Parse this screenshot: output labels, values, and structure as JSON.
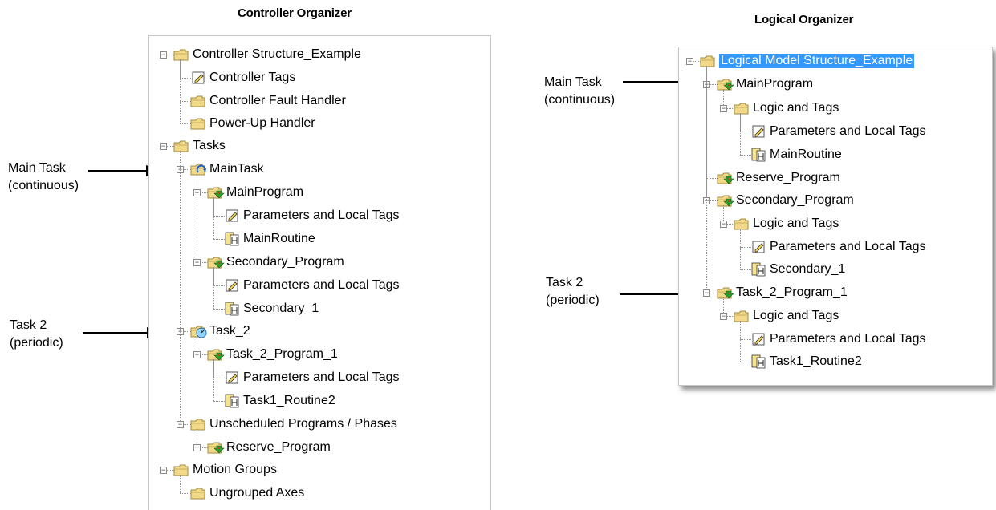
{
  "controller_organizer": {
    "heading": "Controller Organizer",
    "nodes": [
      {
        "label": "Controller Structure_Example",
        "icon": "folder-icon",
        "expander": "−"
      },
      {
        "label": "Controller Tags",
        "icon": "tags-icon"
      },
      {
        "label": "Controller Fault Handler",
        "icon": "folder-icon"
      },
      {
        "label": "Power-Up Handler",
        "icon": "folder-icon"
      },
      {
        "label": "Tasks",
        "icon": "folder-icon",
        "expander": "−"
      },
      {
        "label": "MainTask",
        "icon": "continuous-task-icon",
        "expander": "−"
      },
      {
        "label": "MainProgram",
        "icon": "program-icon",
        "expander": "−"
      },
      {
        "label": "Parameters and Local Tags",
        "icon": "tags-icon"
      },
      {
        "label": "MainRoutine",
        "icon": "routine-icon"
      },
      {
        "label": "Secondary_Program",
        "icon": "program-icon",
        "expander": "−"
      },
      {
        "label": "Parameters and Local Tags",
        "icon": "tags-icon"
      },
      {
        "label": "Secondary_1",
        "icon": "routine-icon"
      },
      {
        "label": "Task_2",
        "icon": "periodic-task-icon",
        "expander": "−"
      },
      {
        "label": "Task_2_Program_1",
        "icon": "program-icon",
        "expander": "−"
      },
      {
        "label": "Parameters and Local Tags",
        "icon": "tags-icon"
      },
      {
        "label": "Task1_Routine2",
        "icon": "routine-icon"
      },
      {
        "label": "Unscheduled Programs / Phases",
        "icon": "folder-icon",
        "expander": "−"
      },
      {
        "label": "Reserve_Program",
        "icon": "program-icon",
        "expander": "+"
      },
      {
        "label": "Motion Groups",
        "icon": "folder-icon",
        "expander": "−"
      },
      {
        "label": "Ungrouped Axes",
        "icon": "folder-icon"
      }
    ],
    "annotations": [
      {
        "line1": "Main Task",
        "line2": "(continuous)"
      },
      {
        "line1": "Task 2",
        "line2": "(periodic)"
      }
    ]
  },
  "logical_organizer": {
    "heading": "Logical Organizer",
    "nodes": [
      {
        "label": "Logical Model Structure_Example",
        "icon": "folder-icon",
        "expander": "−",
        "selected": true
      },
      {
        "label": "MainProgram",
        "icon": "program-icon",
        "expander": "−"
      },
      {
        "label": "Logic and Tags",
        "icon": "folder-icon",
        "expander": "−"
      },
      {
        "label": "Parameters and Local Tags",
        "icon": "tags-icon"
      },
      {
        "label": "MainRoutine",
        "icon": "routine-icon"
      },
      {
        "label": "Reserve_Program",
        "icon": "program-icon"
      },
      {
        "label": "Secondary_Program",
        "icon": "program-icon",
        "expander": "−"
      },
      {
        "label": "Logic and Tags",
        "icon": "folder-icon",
        "expander": "−"
      },
      {
        "label": "Parameters and Local Tags",
        "icon": "tags-icon"
      },
      {
        "label": "Secondary_1",
        "icon": "routine-icon"
      },
      {
        "label": "Task_2_Program_1",
        "icon": "program-icon",
        "expander": "−"
      },
      {
        "label": "Logic and Tags",
        "icon": "folder-icon",
        "expander": "−"
      },
      {
        "label": "Parameters and Local Tags",
        "icon": "tags-icon"
      },
      {
        "label": "Task1_Routine2",
        "icon": "routine-icon"
      }
    ],
    "annotations": [
      {
        "line1": "Main Task",
        "line2": "(continuous)"
      },
      {
        "line1": "Task 2",
        "line2": "(periodic)"
      }
    ]
  },
  "colors": {
    "selection": "#3399ff",
    "folder": "#f2d98a",
    "program_arrow": "#2a9d2a"
  }
}
